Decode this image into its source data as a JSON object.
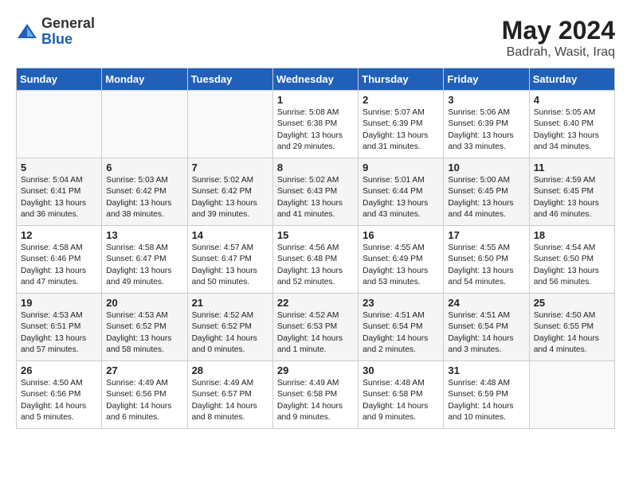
{
  "logo": {
    "general": "General",
    "blue": "Blue"
  },
  "title": "May 2024",
  "location": "Badrah, Wasit, Iraq",
  "days_of_week": [
    "Sunday",
    "Monday",
    "Tuesday",
    "Wednesday",
    "Thursday",
    "Friday",
    "Saturday"
  ],
  "weeks": [
    [
      {
        "day": "",
        "content": ""
      },
      {
        "day": "",
        "content": ""
      },
      {
        "day": "",
        "content": ""
      },
      {
        "day": "1",
        "content": "Sunrise: 5:08 AM\nSunset: 6:38 PM\nDaylight: 13 hours\nand 29 minutes."
      },
      {
        "day": "2",
        "content": "Sunrise: 5:07 AM\nSunset: 6:39 PM\nDaylight: 13 hours\nand 31 minutes."
      },
      {
        "day": "3",
        "content": "Sunrise: 5:06 AM\nSunset: 6:39 PM\nDaylight: 13 hours\nand 33 minutes."
      },
      {
        "day": "4",
        "content": "Sunrise: 5:05 AM\nSunset: 6:40 PM\nDaylight: 13 hours\nand 34 minutes."
      }
    ],
    [
      {
        "day": "5",
        "content": "Sunrise: 5:04 AM\nSunset: 6:41 PM\nDaylight: 13 hours\nand 36 minutes."
      },
      {
        "day": "6",
        "content": "Sunrise: 5:03 AM\nSunset: 6:42 PM\nDaylight: 13 hours\nand 38 minutes."
      },
      {
        "day": "7",
        "content": "Sunrise: 5:02 AM\nSunset: 6:42 PM\nDaylight: 13 hours\nand 39 minutes."
      },
      {
        "day": "8",
        "content": "Sunrise: 5:02 AM\nSunset: 6:43 PM\nDaylight: 13 hours\nand 41 minutes."
      },
      {
        "day": "9",
        "content": "Sunrise: 5:01 AM\nSunset: 6:44 PM\nDaylight: 13 hours\nand 43 minutes."
      },
      {
        "day": "10",
        "content": "Sunrise: 5:00 AM\nSunset: 6:45 PM\nDaylight: 13 hours\nand 44 minutes."
      },
      {
        "day": "11",
        "content": "Sunrise: 4:59 AM\nSunset: 6:45 PM\nDaylight: 13 hours\nand 46 minutes."
      }
    ],
    [
      {
        "day": "12",
        "content": "Sunrise: 4:58 AM\nSunset: 6:46 PM\nDaylight: 13 hours\nand 47 minutes."
      },
      {
        "day": "13",
        "content": "Sunrise: 4:58 AM\nSunset: 6:47 PM\nDaylight: 13 hours\nand 49 minutes."
      },
      {
        "day": "14",
        "content": "Sunrise: 4:57 AM\nSunset: 6:47 PM\nDaylight: 13 hours\nand 50 minutes."
      },
      {
        "day": "15",
        "content": "Sunrise: 4:56 AM\nSunset: 6:48 PM\nDaylight: 13 hours\nand 52 minutes."
      },
      {
        "day": "16",
        "content": "Sunrise: 4:55 AM\nSunset: 6:49 PM\nDaylight: 13 hours\nand 53 minutes."
      },
      {
        "day": "17",
        "content": "Sunrise: 4:55 AM\nSunset: 6:50 PM\nDaylight: 13 hours\nand 54 minutes."
      },
      {
        "day": "18",
        "content": "Sunrise: 4:54 AM\nSunset: 6:50 PM\nDaylight: 13 hours\nand 56 minutes."
      }
    ],
    [
      {
        "day": "19",
        "content": "Sunrise: 4:53 AM\nSunset: 6:51 PM\nDaylight: 13 hours\nand 57 minutes."
      },
      {
        "day": "20",
        "content": "Sunrise: 4:53 AM\nSunset: 6:52 PM\nDaylight: 13 hours\nand 58 minutes."
      },
      {
        "day": "21",
        "content": "Sunrise: 4:52 AM\nSunset: 6:52 PM\nDaylight: 14 hours\nand 0 minutes."
      },
      {
        "day": "22",
        "content": "Sunrise: 4:52 AM\nSunset: 6:53 PM\nDaylight: 14 hours\nand 1 minute."
      },
      {
        "day": "23",
        "content": "Sunrise: 4:51 AM\nSunset: 6:54 PM\nDaylight: 14 hours\nand 2 minutes."
      },
      {
        "day": "24",
        "content": "Sunrise: 4:51 AM\nSunset: 6:54 PM\nDaylight: 14 hours\nand 3 minutes."
      },
      {
        "day": "25",
        "content": "Sunrise: 4:50 AM\nSunset: 6:55 PM\nDaylight: 14 hours\nand 4 minutes."
      }
    ],
    [
      {
        "day": "26",
        "content": "Sunrise: 4:50 AM\nSunset: 6:56 PM\nDaylight: 14 hours\nand 5 minutes."
      },
      {
        "day": "27",
        "content": "Sunrise: 4:49 AM\nSunset: 6:56 PM\nDaylight: 14 hours\nand 6 minutes."
      },
      {
        "day": "28",
        "content": "Sunrise: 4:49 AM\nSunset: 6:57 PM\nDaylight: 14 hours\nand 8 minutes."
      },
      {
        "day": "29",
        "content": "Sunrise: 4:49 AM\nSunset: 6:58 PM\nDaylight: 14 hours\nand 9 minutes."
      },
      {
        "day": "30",
        "content": "Sunrise: 4:48 AM\nSunset: 6:58 PM\nDaylight: 14 hours\nand 9 minutes."
      },
      {
        "day": "31",
        "content": "Sunrise: 4:48 AM\nSunset: 6:59 PM\nDaylight: 14 hours\nand 10 minutes."
      },
      {
        "day": "",
        "content": ""
      }
    ]
  ]
}
